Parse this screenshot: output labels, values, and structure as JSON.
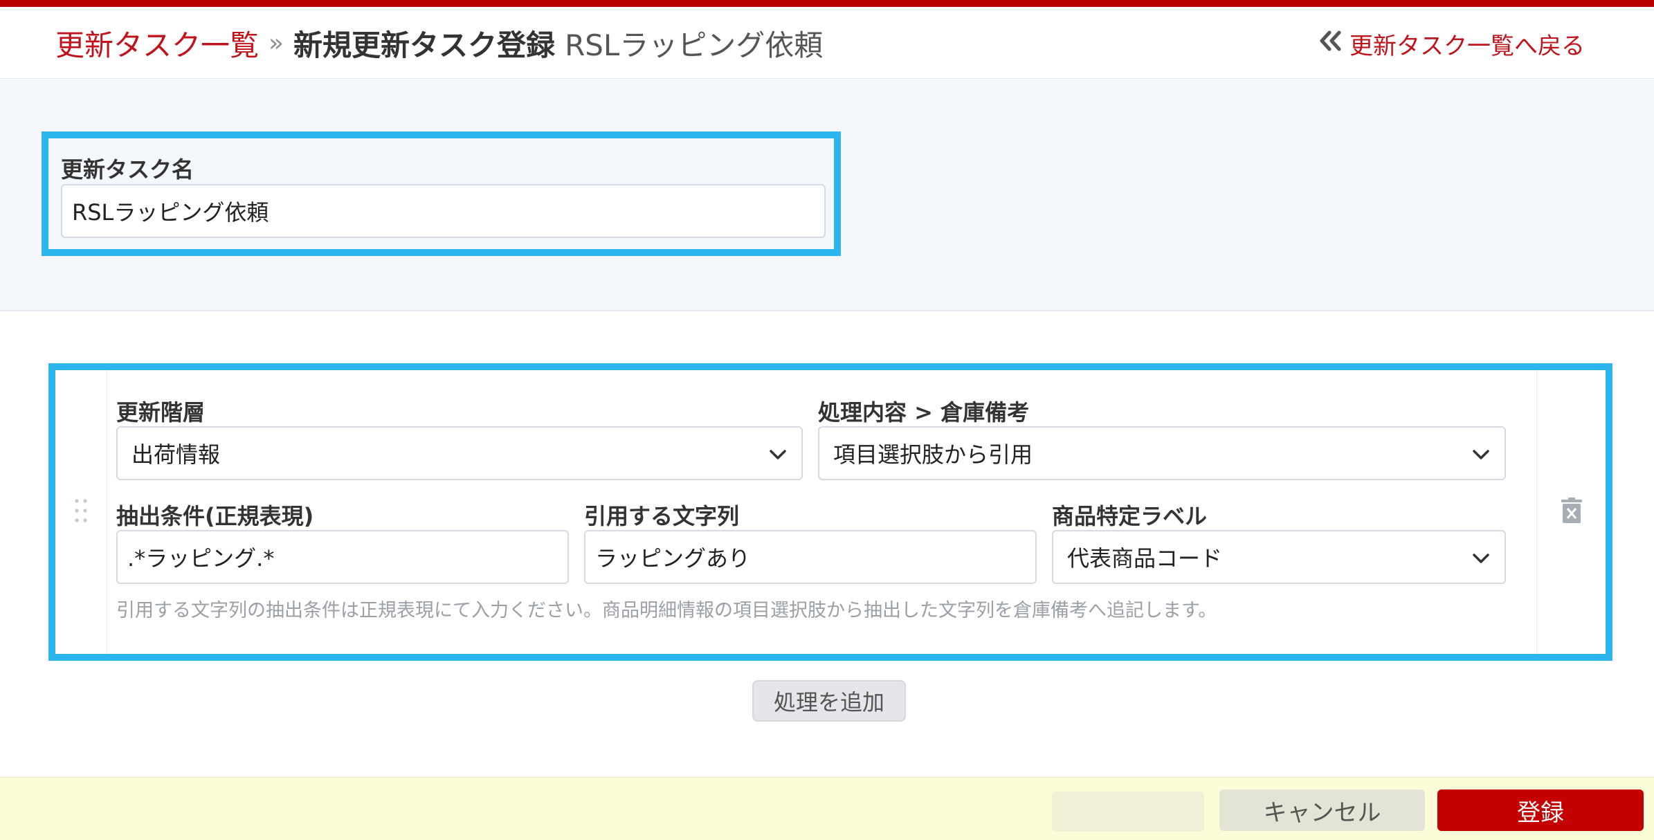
{
  "header": {
    "breadcrumb_link": "更新タスク一覧",
    "separator": "»",
    "current": "新規更新タスク登録",
    "sub": "RSLラッピング依頼",
    "back_link": "更新タスク一覧へ戻る"
  },
  "task_name": {
    "label": "更新タスク名",
    "value": "RSLラッピング依頼"
  },
  "process": {
    "level_label": "更新階層",
    "level_value": "出荷情報",
    "content_label": "処理内容 > 倉庫備考",
    "content_value": "項目選択肢から引用",
    "condition_label": "抽出条件(正規表現)",
    "condition_value": ".*ラッピング.*",
    "quote_label": "引用する文字列",
    "quote_value": "ラッピングあり",
    "product_label": "商品特定ラベル",
    "product_value": "代表商品コード",
    "hint": "引用する文字列の抽出条件は正規表現にて入力ください。商品明細情報の項目選択肢から抽出した文字列を倉庫備考へ追記します。"
  },
  "add_button": "処理を追加",
  "footer": {
    "cancel": "キャンセル",
    "submit": "登録"
  },
  "icons": {
    "back": "double-chevron-left-icon",
    "drag": "drag-handle-icon",
    "delete": "trash-icon",
    "select": "chevron-down-icon"
  },
  "colors": {
    "brand_red": "#c0141c",
    "highlight_blue": "#2bb7ee",
    "submit_red": "#c40000",
    "footer_bg": "#fdfcd9"
  }
}
